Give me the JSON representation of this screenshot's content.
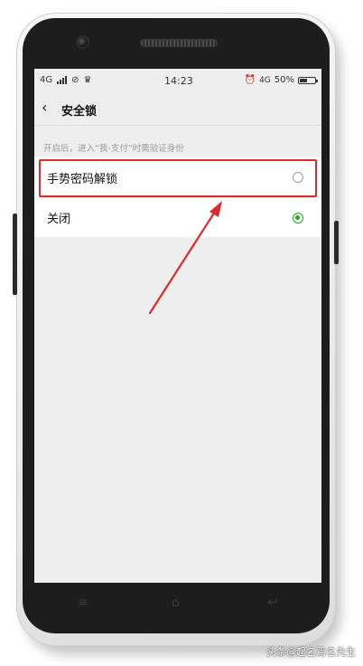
{
  "status_bar": {
    "network": "4G",
    "time": "14:23",
    "net_badge": "4G",
    "battery_text": "50%",
    "battery_level": 0.5
  },
  "header": {
    "title": "安全锁"
  },
  "hint": "开启后，进入“我-支付”时需验证身份",
  "options": [
    {
      "label": "手势密码解锁",
      "selected": false
    },
    {
      "label": "关闭",
      "selected": true
    }
  ],
  "colors": {
    "selected_green": "#1aad19",
    "annotation_red": "#e02a2a"
  },
  "watermark": "头条@起名篇名先生"
}
